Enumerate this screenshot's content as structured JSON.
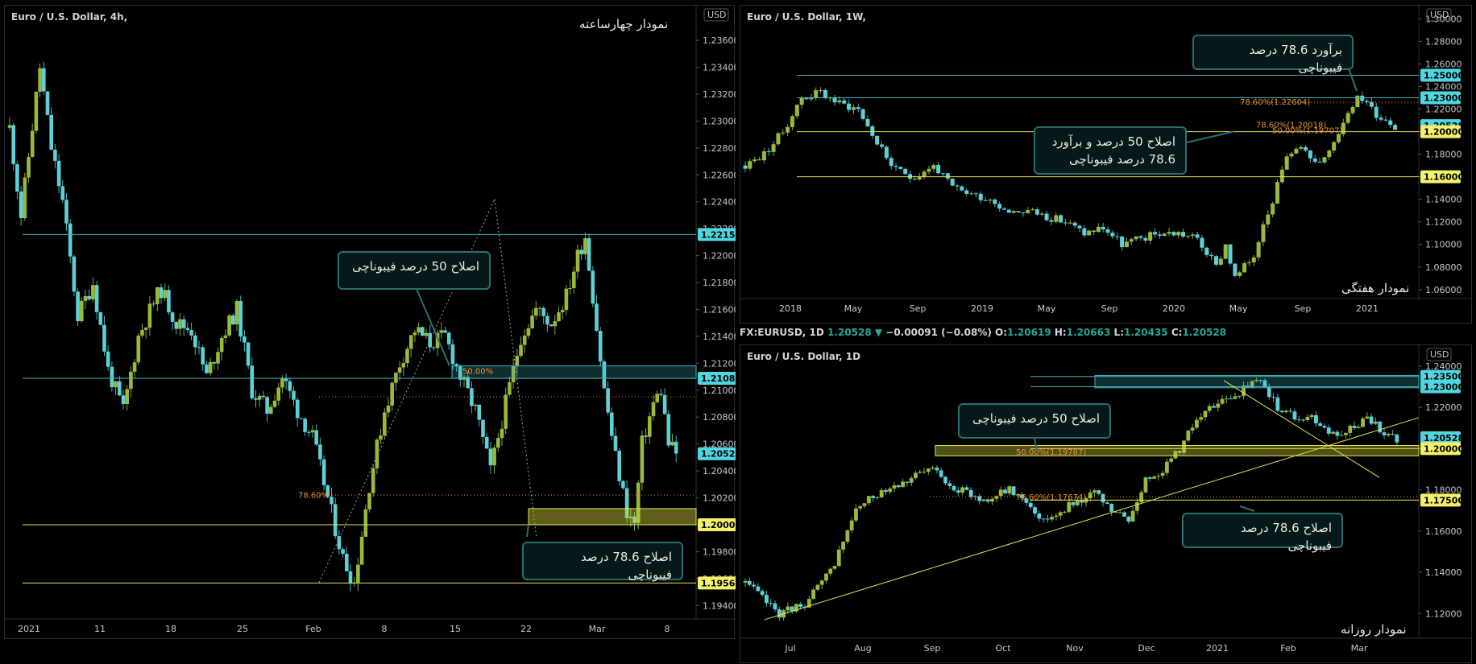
{
  "panels": {
    "h4": {
      "title": "Euro / U.S. Dollar, 4h,",
      "caption": "نمودار چهارساعته",
      "currency": "USD",
      "callouts": [
        "اصلاح 50 درصد فیبوناچی",
        "اصلاح 78.6 درصد فیبوناچی"
      ],
      "fib_labels": [
        "50.00%",
        "78.60%"
      ]
    },
    "w1": {
      "title": "Euro / U.S. Dollar, 1W,",
      "caption": "نمودار هفتگی",
      "currency": "USD",
      "callouts": [
        "برآورد 78.6 درصد فیبوناچی",
        "اصلاح 50 درصد و برآورد 78.6 درصد فیبوناچی"
      ],
      "fib_labels": [
        "78.60%(1.22604)",
        "78.60%(1.20018)",
        "50.00%(1.19707)"
      ]
    },
    "d1": {
      "title": "Euro / U.S. Dollar, 1D",
      "caption": "نمودار روزانه",
      "currency": "USD",
      "callouts": [
        "اصلاح 50 درصد فیبوناچی",
        "اصلاح 78.6 درصد فیبوناچی"
      ],
      "fib_labels": [
        "50.00%(1.19787)",
        "78.60%(1.17674)"
      ]
    }
  },
  "symbol_header": {
    "symbol": "FX:EURUSD, 1D",
    "last": "1.20528",
    "change": "−0.00091 (−0.08%)",
    "o_label": "O:",
    "o": "1.20619",
    "h_label": "H:",
    "h": "1.20663",
    "l_label": "L:",
    "l": "1.20435",
    "c_label": "C:",
    "c": "1.20528"
  },
  "colors": {
    "up": "#26a69a",
    "down": "#5fd0d6",
    "body_up": "#9ab93a",
    "level_line": "#3fb6c0",
    "yellow": "#e6e64a",
    "fib": "#e8913a"
  },
  "chart_data": [
    {
      "type": "candlestick",
      "name_ref": "h4",
      "x_ticks": [
        "2021",
        "11",
        "18",
        "25",
        "Feb",
        "8",
        "15",
        "22",
        "Mar",
        "8"
      ],
      "y_ticks": [
        "1.23600",
        "1.23400",
        "1.23200",
        "1.23000",
        "1.22800",
        "1.22600",
        "1.22400",
        "1.22200",
        "1.22000",
        "1.21800",
        "1.21600",
        "1.21400",
        "1.21200",
        "1.21000",
        "1.20800",
        "1.20600",
        "1.20400",
        "1.20200",
        "1.20000",
        "1.19800",
        "1.19600",
        "1.19400"
      ],
      "ylim": [
        1.193,
        1.2375
      ],
      "path": [
        [
          0,
          1.2295
        ],
        [
          3,
          1.223
        ],
        [
          8,
          1.234
        ],
        [
          11,
          1.228
        ],
        [
          14,
          1.224
        ],
        [
          18,
          1.2155
        ],
        [
          22,
          1.218
        ],
        [
          26,
          1.2115
        ],
        [
          30,
          1.2085
        ],
        [
          34,
          1.214
        ],
        [
          38,
          1.2165
        ],
        [
          40,
          1.2175
        ],
        [
          44,
          1.215
        ],
        [
          48,
          1.2145
        ],
        [
          52,
          1.211
        ],
        [
          56,
          1.214
        ],
        [
          60,
          1.216
        ],
        [
          64,
          1.21
        ],
        [
          68,
          1.2085
        ],
        [
          72,
          1.211
        ],
        [
          76,
          1.2085
        ],
        [
          80,
          1.2065
        ],
        [
          84,
          1.202
        ],
        [
          88,
          1.1975
        ],
        [
          91,
          1.1957
        ],
        [
          95,
          1.203
        ],
        [
          99,
          1.2085
        ],
        [
          103,
          1.212
        ],
        [
          107,
          1.2145
        ],
        [
          111,
          1.2135
        ],
        [
          115,
          1.214
        ],
        [
          119,
          1.211
        ],
        [
          123,
          1.2085
        ],
        [
          127,
          1.204
        ],
        [
          131,
          1.209
        ],
        [
          135,
          1.214
        ],
        [
          139,
          1.216
        ],
        [
          143,
          1.215
        ],
        [
          147,
          1.217
        ],
        [
          150,
          1.22
        ],
        [
          152,
          1.2215
        ],
        [
          154,
          1.217
        ],
        [
          157,
          1.21
        ],
        [
          160,
          1.205
        ],
        [
          163,
          1.201
        ],
        [
          165,
          1.2
        ],
        [
          167,
          1.206
        ],
        [
          170,
          1.209
        ],
        [
          172,
          1.21
        ],
        [
          174,
          1.206
        ],
        [
          176,
          1.2053
        ]
      ],
      "levels": [
        {
          "price": "1.22157",
          "value": 1.22157,
          "tag": "cyan"
        },
        {
          "price": "1.21088",
          "value": 1.21088,
          "tag": "cyan"
        },
        {
          "price": "1.20528",
          "value": 1.20528,
          "tag": "cyan"
        },
        {
          "price": "1.20000",
          "value": 1.2,
          "tag": "yellow"
        },
        {
          "price": "1.19567",
          "value": 1.19567,
          "tag": "yellow"
        }
      ]
    },
    {
      "type": "candlestick",
      "name_ref": "w1",
      "x_ticks": [
        "2018",
        "May",
        "Sep",
        "2019",
        "May",
        "Sep",
        "2020",
        "May",
        "Sep",
        "2021"
      ],
      "y_ticks": [
        "1.30000",
        "1.28000",
        "1.26000",
        "1.24000",
        "1.22000",
        "1.20000",
        "1.18000",
        "1.16000",
        "1.14000",
        "1.12000",
        "1.10000",
        "1.08000",
        "1.06000"
      ],
      "ylim": [
        1.052,
        1.306
      ],
      "path": [
        [
          0,
          1.17
        ],
        [
          4,
          1.18
        ],
        [
          8,
          1.2
        ],
        [
          12,
          1.23
        ],
        [
          16,
          1.235
        ],
        [
          20,
          1.225
        ],
        [
          24,
          1.22
        ],
        [
          28,
          1.19
        ],
        [
          32,
          1.165
        ],
        [
          36,
          1.16
        ],
        [
          40,
          1.17
        ],
        [
          44,
          1.15
        ],
        [
          48,
          1.145
        ],
        [
          52,
          1.14
        ],
        [
          56,
          1.13
        ],
        [
          60,
          1.13
        ],
        [
          64,
          1.125
        ],
        [
          68,
          1.12
        ],
        [
          72,
          1.11
        ],
        [
          76,
          1.115
        ],
        [
          80,
          1.1
        ],
        [
          84,
          1.105
        ],
        [
          88,
          1.11
        ],
        [
          92,
          1.11
        ],
        [
          96,
          1.105
        ],
        [
          100,
          1.08
        ],
        [
          102,
          1.1
        ],
        [
          104,
          1.07
        ],
        [
          106,
          1.08
        ],
        [
          108,
          1.09
        ],
        [
          110,
          1.12
        ],
        [
          112,
          1.14
        ],
        [
          114,
          1.17
        ],
        [
          116,
          1.18
        ],
        [
          118,
          1.19
        ],
        [
          120,
          1.175
        ],
        [
          122,
          1.17
        ],
        [
          124,
          1.18
        ],
        [
          126,
          1.2
        ],
        [
          128,
          1.22
        ],
        [
          130,
          1.23
        ],
        [
          132,
          1.225
        ],
        [
          134,
          1.215
        ],
        [
          136,
          1.21
        ],
        [
          138,
          1.205
        ]
      ],
      "levels": [
        {
          "price": "1.25000",
          "value": 1.25,
          "tag": "cyan"
        },
        {
          "price": "1.23000",
          "value": 1.23,
          "tag": "cyan"
        },
        {
          "price": "1.20528",
          "value": 1.20528,
          "tag": "cyan"
        },
        {
          "price": "1.20000",
          "value": 1.2,
          "tag": "yellow"
        },
        {
          "price": "1.16000",
          "value": 1.16,
          "tag": "yellow"
        }
      ]
    },
    {
      "type": "candlestick",
      "name_ref": "d1",
      "x_ticks": [
        "Jul",
        "Aug",
        "Sep",
        "Oct",
        "Nov",
        "Dec",
        "2021",
        "Feb",
        "Mar"
      ],
      "y_ticks": [
        "1.24000",
        "1.22000",
        "1.20000",
        "1.18000",
        "1.16000",
        "1.14000",
        "1.12000"
      ],
      "ylim": [
        1.108,
        1.247
      ],
      "path": [
        [
          0,
          1.135
        ],
        [
          8,
          1.12
        ],
        [
          14,
          1.125
        ],
        [
          20,
          1.14
        ],
        [
          26,
          1.17
        ],
        [
          32,
          1.18
        ],
        [
          38,
          1.185
        ],
        [
          44,
          1.19
        ],
        [
          50,
          1.18
        ],
        [
          56,
          1.175
        ],
        [
          62,
          1.18
        ],
        [
          66,
          1.175
        ],
        [
          70,
          1.165
        ],
        [
          74,
          1.17
        ],
        [
          78,
          1.175
        ],
        [
          82,
          1.178
        ],
        [
          86,
          1.17
        ],
        [
          90,
          1.165
        ],
        [
          94,
          1.185
        ],
        [
          98,
          1.19
        ],
        [
          102,
          1.2
        ],
        [
          106,
          1.215
        ],
        [
          110,
          1.22
        ],
        [
          114,
          1.225
        ],
        [
          118,
          1.23
        ],
        [
          121,
          1.233
        ],
        [
          125,
          1.22
        ],
        [
          129,
          1.215
        ],
        [
          133,
          1.215
        ],
        [
          136,
          1.21
        ],
        [
          139,
          1.205
        ],
        [
          142,
          1.21
        ],
        [
          146,
          1.215
        ],
        [
          150,
          1.208
        ],
        [
          153,
          1.205
        ]
      ],
      "levels": [
        {
          "price": "1.23500",
          "value": 1.235,
          "tag": "cyan"
        },
        {
          "price": "1.23000",
          "value": 1.23,
          "tag": "cyan"
        },
        {
          "price": "1.20528",
          "value": 1.20528,
          "tag": "cyan"
        },
        {
          "price": "1.20000",
          "value": 1.2,
          "tag": "yellow"
        },
        {
          "price": "1.17500",
          "value": 1.175,
          "tag": "yellow"
        }
      ]
    }
  ]
}
